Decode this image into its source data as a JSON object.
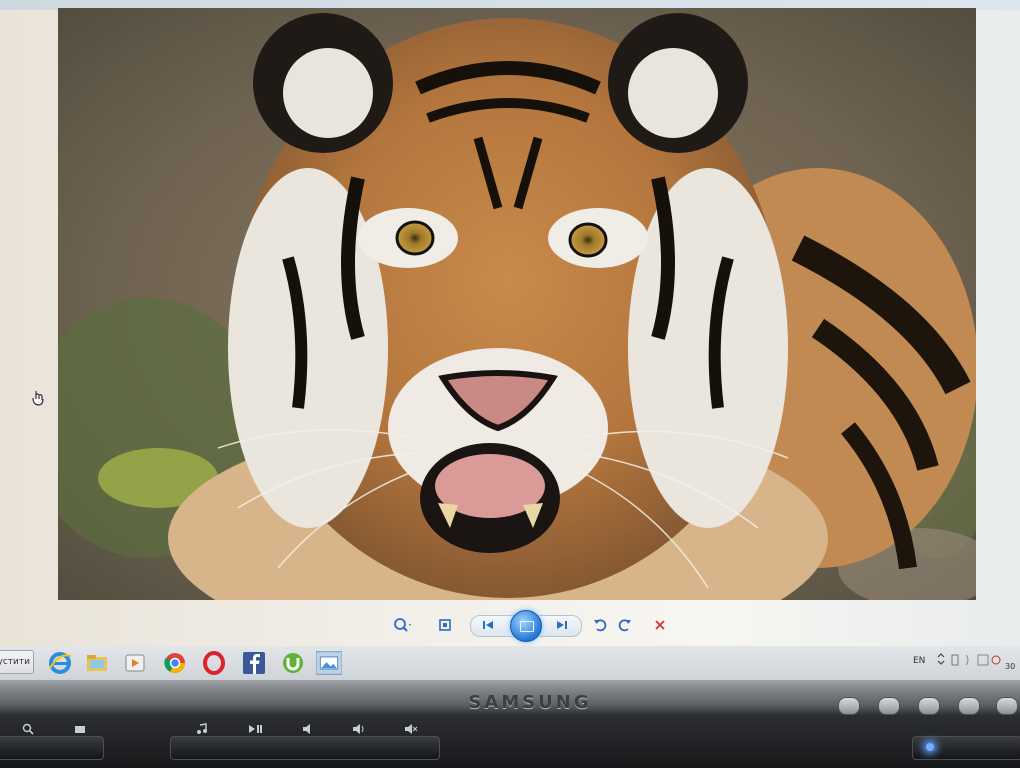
{
  "image": {
    "icon": "tiger-photo"
  },
  "viewer_toolbar": {
    "zoom_icon": "zoom-icon",
    "fit_icon": "actual-size-icon",
    "prev_icon": "previous-icon",
    "slideshow_icon": "slideshow-icon",
    "next_icon": "next-icon",
    "rotate_ccw_icon": "rotate-left-icon",
    "rotate_cw_icon": "rotate-right-icon",
    "delete_icon": "delete-icon"
  },
  "taskbar": {
    "start_label": "устити",
    "apps": [
      "internet-explorer-icon",
      "file-explorer-icon",
      "media-player-icon",
      "chrome-icon",
      "opera-icon",
      "facebook-icon",
      "utorrent-icon",
      "photo-viewer-icon"
    ],
    "language": "EN",
    "clock": "30"
  },
  "monitor": {
    "brand": "SAMSUNG"
  },
  "colors": {
    "accent": "#2477d6",
    "taskbar": "#d6dade"
  }
}
